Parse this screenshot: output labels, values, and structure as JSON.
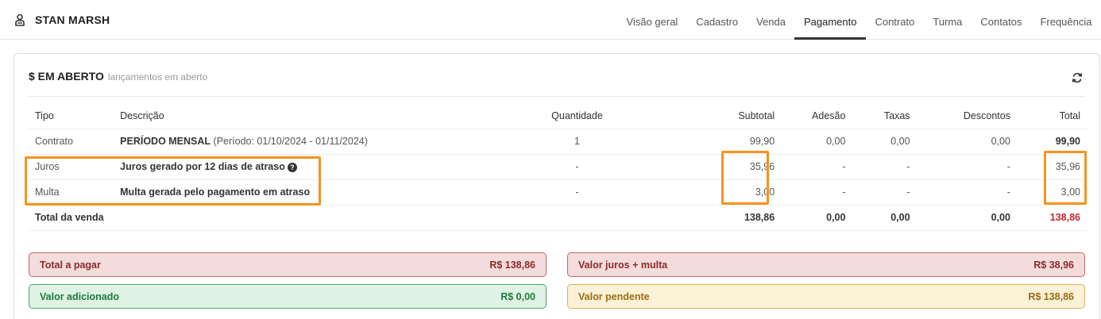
{
  "header": {
    "user_icon": "user-icon",
    "user_name": "STAN MARSH",
    "tabs": [
      {
        "label": "Visão geral",
        "active": false
      },
      {
        "label": "Cadastro",
        "active": false
      },
      {
        "label": "Venda",
        "active": false
      },
      {
        "label": "Pagamento",
        "active": true
      },
      {
        "label": "Contrato",
        "active": false
      },
      {
        "label": "Turma",
        "active": false
      },
      {
        "label": "Contatos",
        "active": false
      },
      {
        "label": "Frequência",
        "active": false
      }
    ]
  },
  "card": {
    "title": "$ EM ABERTO",
    "subtitle": "lançamentos em aberto",
    "refresh_icon": "refresh-icon"
  },
  "table": {
    "headers": {
      "tipo": "Tipo",
      "descricao": "Descrição",
      "quantidade": "Quantidade",
      "subtotal": "Subtotal",
      "adesao": "Adesão",
      "taxas": "Taxas",
      "descontos": "Descontos",
      "total": "Total"
    },
    "rows": [
      {
        "tipo": "Contrato",
        "descricao_bold": "PERÍODO MENSAL",
        "descricao_extra": "(Período: 01/10/2024 - 01/11/2024)",
        "quantidade": "1",
        "subtotal": "99,90",
        "adesao": "0,00",
        "taxas": "0,00",
        "descontos": "0,00",
        "total": "99,90"
      },
      {
        "tipo": "Juros",
        "descricao_bold": "Juros gerado por 12 dias de atraso",
        "quantidade": "-",
        "subtotal": "35,96",
        "adesao": "-",
        "taxas": "-",
        "descontos": "-",
        "total": "35,96"
      },
      {
        "tipo": "Multa",
        "descricao_bold": "Multa gerada pelo pagamento em atraso",
        "quantidade": "-",
        "subtotal": "3,00",
        "adesao": "-",
        "taxas": "-",
        "descontos": "-",
        "total": "3,00"
      }
    ],
    "footer": {
      "label": "Total da venda",
      "subtotal": "138,86",
      "adesao": "0,00",
      "taxas": "0,00",
      "descontos": "0,00",
      "total": "138,86"
    }
  },
  "summary": {
    "total_a_pagar_label": "Total a pagar",
    "total_a_pagar_value": "R$ 138,86",
    "juros_multa_label": "Valor juros + multa",
    "juros_multa_value": "R$ 38,96",
    "adicionado_label": "Valor adicionado",
    "adicionado_value": "R$ 0,00",
    "pendente_label": "Valor pendente",
    "pendente_value": "R$ 138,86"
  },
  "colors": {
    "highlight": "#f7931e",
    "danger": "#c0282d"
  }
}
